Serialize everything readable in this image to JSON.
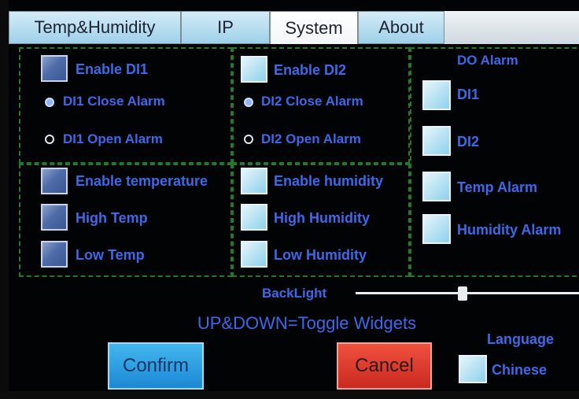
{
  "tabs": [
    {
      "label": "Temp&Humidity",
      "active": false
    },
    {
      "label": "IP",
      "active": false
    },
    {
      "label": "System",
      "active": true
    },
    {
      "label": "About",
      "active": false
    }
  ],
  "di1": {
    "enable_label": "Enable DI1",
    "close_alarm_label": "DI1 Close Alarm",
    "open_alarm_label": "DI1 Open Alarm",
    "selected": "close"
  },
  "di2": {
    "enable_label": "Enable DI2",
    "close_alarm_label": "DI2 Close Alarm",
    "open_alarm_label": "DI2 Open Alarm",
    "selected": "close"
  },
  "sensors": {
    "enable_temperature_label": "Enable temperature",
    "high_temp_label": "High Temp",
    "low_temp_label": "Low Temp",
    "enable_humidity_label": "Enable humidity",
    "high_humidity_label": "High Humidity",
    "low_humidity_label": "Low Humidity"
  },
  "do_alarm": {
    "title": "DO Alarm",
    "items": [
      "DI1",
      "DI2",
      "Temp Alarm",
      "Humidity Alarm"
    ]
  },
  "backlight": {
    "label": "BackLight",
    "level_fraction": 0.48
  },
  "hint_text": "UP&DOWN=Toggle Widgets",
  "buttons": {
    "confirm_label": "Confirm",
    "cancel_label": "Cancel"
  },
  "language": {
    "title": "Language",
    "option_label": "Chinese"
  },
  "colors": {
    "label_blue": "#3d69e8",
    "panel_border": "#1f7a2a",
    "confirm_bg": "#2b9fe3",
    "cancel_bg": "#e2402f"
  }
}
